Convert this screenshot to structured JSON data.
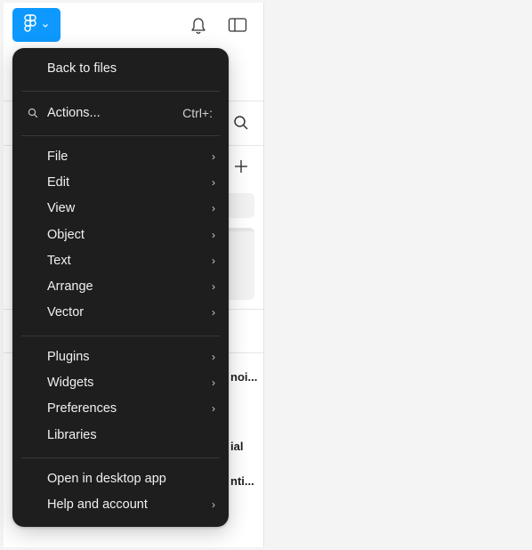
{
  "toolbar": {
    "logo_icon": "figma-logo-icon",
    "logo_dropdown_icon": "chevron-down-icon",
    "notifications_icon": "bell-icon",
    "panel_toggle_icon": "sidebar-toggle-icon"
  },
  "background_panel": {
    "search_icon": "search-icon",
    "add_icon": "plus-icon",
    "truncated_items": [
      "noi...",
      "ial",
      "nti..."
    ]
  },
  "main_menu": {
    "back_to_files": "Back to files",
    "actions": {
      "icon": "search-icon",
      "label": "Actions...",
      "shortcut": "Ctrl+:"
    },
    "sections": [
      [
        {
          "label": "File",
          "submenu": true
        },
        {
          "label": "Edit",
          "submenu": true
        },
        {
          "label": "View",
          "submenu": true
        },
        {
          "label": "Object",
          "submenu": true
        },
        {
          "label": "Text",
          "submenu": true
        },
        {
          "label": "Arrange",
          "submenu": true
        },
        {
          "label": "Vector",
          "submenu": true
        }
      ],
      [
        {
          "label": "Plugins",
          "submenu": true
        },
        {
          "label": "Widgets",
          "submenu": true
        },
        {
          "label": "Preferences",
          "submenu": true
        },
        {
          "label": "Libraries",
          "submenu": false
        }
      ],
      [
        {
          "label": "Open in desktop app",
          "submenu": false
        },
        {
          "label": "Help and account",
          "submenu": true
        }
      ]
    ],
    "chevron_glyph": "›"
  },
  "colors": {
    "accent": "#0d99ff",
    "menu_bg": "#1e1e1e",
    "menu_text": "#f0f0f0",
    "page_bg": "#f4f4f4"
  }
}
